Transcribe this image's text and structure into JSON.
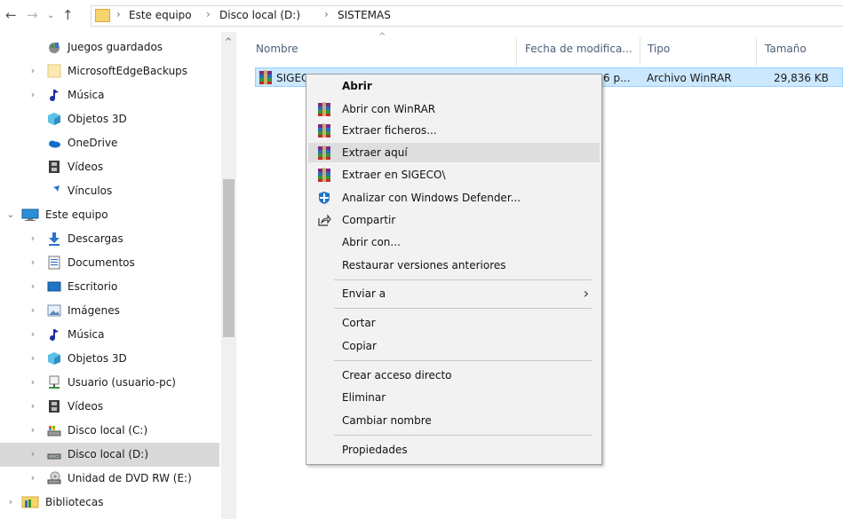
{
  "address_bar": {
    "breadcrumbs": [
      "Este equipo",
      "Disco local (D:)",
      "SISTEMAS"
    ],
    "separator": "›"
  },
  "nav_pane": {
    "items": [
      {
        "label": "Juegos guardados",
        "icon": "saved-games-icon",
        "expander": ""
      },
      {
        "label": "MicrosoftEdgeBackups",
        "icon": "folder-icon",
        "expander": "›"
      },
      {
        "label": "Música",
        "icon": "music-icon",
        "expander": "›"
      },
      {
        "label": "Objetos 3D",
        "icon": "objects-3d-icon",
        "expander": ""
      },
      {
        "label": "OneDrive",
        "icon": "onedrive-icon",
        "expander": ""
      },
      {
        "label": "Vídeos",
        "icon": "videos-icon",
        "expander": ""
      },
      {
        "label": "Vínculos",
        "icon": "links-icon",
        "expander": ""
      },
      {
        "label": "Este equipo",
        "icon": "this-pc-icon",
        "expander": "⌄"
      },
      {
        "label": "Descargas",
        "icon": "downloads-icon",
        "expander": "›"
      },
      {
        "label": "Documentos",
        "icon": "documents-icon",
        "expander": "›"
      },
      {
        "label": "Escritorio",
        "icon": "desktop-icon",
        "expander": "›"
      },
      {
        "label": "Imágenes",
        "icon": "pictures-icon",
        "expander": "›"
      },
      {
        "label": "Música",
        "icon": "music-icon",
        "expander": "›"
      },
      {
        "label": "Objetos 3D",
        "icon": "objects-3d-icon",
        "expander": "›"
      },
      {
        "label": "Usuario (usuario-pc)",
        "icon": "network-user-icon",
        "expander": "›"
      },
      {
        "label": "Vídeos",
        "icon": "videos-icon",
        "expander": "›"
      },
      {
        "label": "Disco local (C:)",
        "icon": "drive-c-icon",
        "expander": "›"
      },
      {
        "label": "Disco local (D:)",
        "icon": "drive-d-icon",
        "expander": "›"
      },
      {
        "label": "Unidad de DVD RW (E:)",
        "icon": "dvd-drive-icon",
        "expander": "›"
      },
      {
        "label": "Bibliotecas",
        "icon": "libraries-icon",
        "expander": "›"
      }
    ],
    "selected": "Disco local (D:)"
  },
  "file_list": {
    "columns": {
      "name": "Nombre",
      "date": "Fecha de modifica...",
      "type": "Tipo",
      "size": "Tamaño"
    },
    "rows": [
      {
        "name": "SIGECO",
        "date": "6 p...",
        "type": "Archivo WinRAR",
        "size": "29,836 KB"
      }
    ]
  },
  "context_menu": {
    "items": [
      {
        "label": "Abrir",
        "bold": true,
        "icon": ""
      },
      {
        "label": "Abrir con WinRAR",
        "icon": "winrar-icon"
      },
      {
        "label": "Extraer ficheros...",
        "icon": "winrar-icon"
      },
      {
        "label": "Extraer aquí",
        "icon": "winrar-icon",
        "highlighted": true
      },
      {
        "label": "Extraer en SIGECO\\",
        "icon": "winrar-icon"
      },
      {
        "label": "Analizar con Windows Defender...",
        "icon": "windows-defender-icon"
      },
      {
        "label": "Compartir",
        "icon": "share-icon"
      },
      {
        "label": "Abrir con...",
        "icon": ""
      },
      {
        "label": "Restaurar versiones anteriores",
        "icon": ""
      },
      {
        "label": "Enviar a",
        "icon": "",
        "submenu": true
      },
      {
        "label": "Cortar",
        "icon": ""
      },
      {
        "label": "Copiar",
        "icon": ""
      },
      {
        "label": "Crear acceso directo",
        "icon": ""
      },
      {
        "label": "Eliminar",
        "icon": ""
      },
      {
        "label": "Cambiar nombre",
        "icon": ""
      },
      {
        "label": "Propiedades",
        "icon": ""
      }
    ],
    "submenu_arrow": "›"
  },
  "colors": {
    "selection": "#cce8ff",
    "nav_selected": "#d9d9d9",
    "menu_background": "#f2f2f2",
    "menu_hover": "#dedede",
    "header_text": "#4c607a"
  }
}
